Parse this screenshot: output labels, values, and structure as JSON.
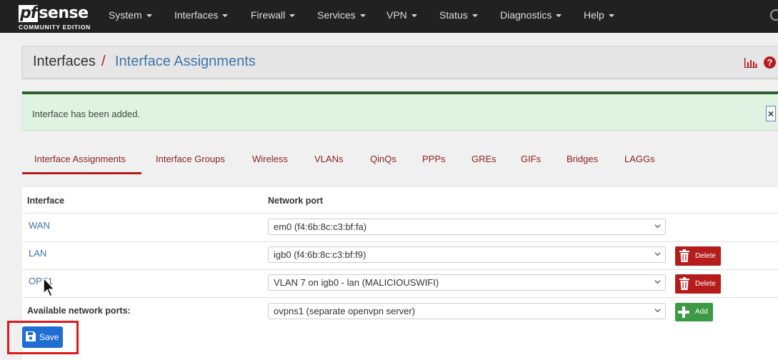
{
  "brand": {
    "logo_pf": "pf",
    "logo_sense": "sense",
    "edition": "COMMUNITY EDITION"
  },
  "nav": {
    "items": [
      "System",
      "Interfaces",
      "Firewall",
      "Services",
      "VPN",
      "Status",
      "Diagnostics",
      "Help"
    ]
  },
  "breadcrumb": {
    "root": "Interfaces",
    "separator": "/",
    "current": "Interface Assignments"
  },
  "alert": {
    "message": "Interface has been added.",
    "close": "×"
  },
  "tabs": [
    "Interface Assignments",
    "Interface Groups",
    "Wireless",
    "VLANs",
    "QinQs",
    "PPPs",
    "GREs",
    "GIFs",
    "Bridges",
    "LAGGs"
  ],
  "active_tab": "Interface Assignments",
  "table": {
    "headers": {
      "interface": "Interface",
      "network_port": "Network port"
    },
    "rows": [
      {
        "interface": "WAN",
        "port": "em0 (f4:6b:8c:c3:bf:fa)",
        "delete": ""
      },
      {
        "interface": "LAN",
        "port": "igb0 (f4:6b:8c:c3:bf:f9)",
        "delete": "Delete"
      },
      {
        "interface": "OPT1",
        "port": "VLAN 7 on igb0 - lan (MALICIOUSWIFI)",
        "delete": "Delete"
      }
    ],
    "available": {
      "label": "Available network ports:",
      "port": "ovpns1 (separate openvpn server)",
      "add": "Add"
    }
  },
  "save": {
    "label": "Save"
  },
  "colors": {
    "navbar": "#212121",
    "accent_red": "#b71c1c",
    "link_blue": "#3e75a8",
    "success_bg": "#e0f2e1",
    "save_blue": "#1f6ed4",
    "add_green": "#3d9a44",
    "highlight": "#e3161b"
  }
}
